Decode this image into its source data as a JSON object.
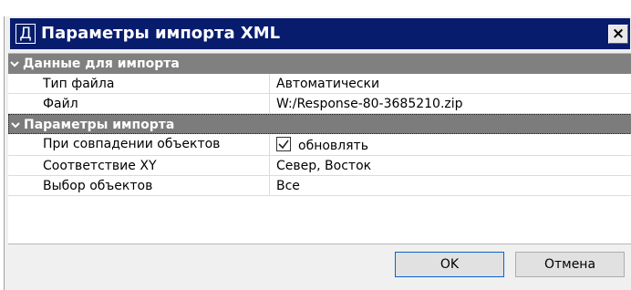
{
  "window": {
    "icon_letter": "Д",
    "title": "Параметры импорта XML",
    "close_glyph": "×"
  },
  "sections": [
    {
      "title": "Данные для импорта",
      "rows": [
        {
          "name": "Тип файла",
          "value": "Автоматически"
        },
        {
          "name": "Файл",
          "value": "W:/Response-80-3685210.zip"
        }
      ]
    },
    {
      "title": "Параметры импорта",
      "rows": [
        {
          "name": "При совпадении объектов",
          "value": "обновлять",
          "checked": true
        },
        {
          "name": "Соответствие XY",
          "value": "Север, Восток"
        },
        {
          "name": "Выбор объектов",
          "value": "Все"
        }
      ]
    }
  ],
  "buttons": {
    "ok": "OK",
    "cancel": "Отмена"
  }
}
